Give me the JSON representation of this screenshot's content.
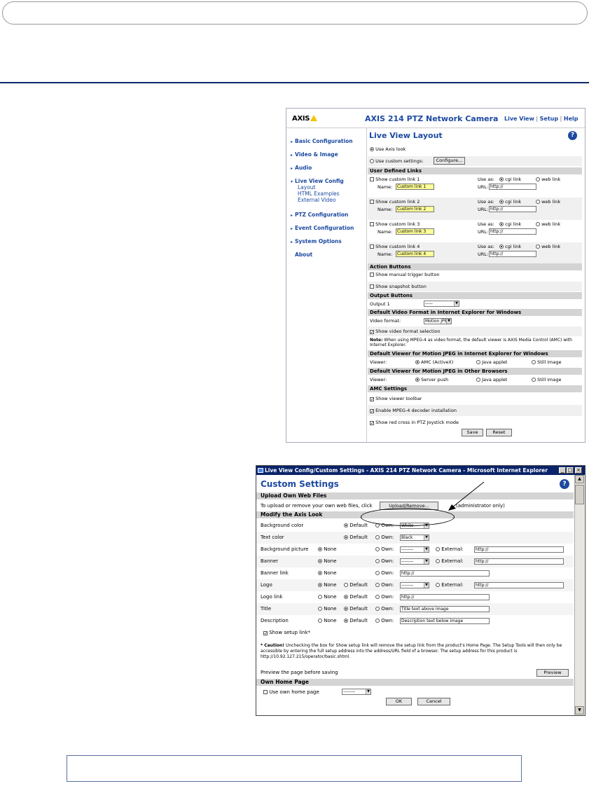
{
  "shot1": {
    "brand": "AXIS",
    "camera_title": "AXIS 214 PTZ Network Camera",
    "top_links": [
      "Live View",
      "Setup",
      "Help"
    ],
    "nav": [
      {
        "label": "Basic Configuration"
      },
      {
        "label": "Video & Image"
      },
      {
        "label": "Audio"
      },
      {
        "label": "Live View Config"
      },
      {
        "label": "PTZ Configuration"
      },
      {
        "label": "Event Configuration"
      },
      {
        "label": "System Options"
      },
      {
        "label": "About"
      }
    ],
    "nav_sub": [
      "Layout",
      "HTML Examples",
      "External Video"
    ],
    "page_title": "Live View Layout",
    "help_glyph": "?",
    "use_axis_look": "Use Axis look",
    "use_custom": "Use custom settings:",
    "configure_btn": "Configure...",
    "sec_user_links": "User Defined Links",
    "links": [
      {
        "show": "Show custom link 1",
        "name_label": "Name:",
        "name": "Custom link 1",
        "use_as": "Use as:",
        "cgi": "cgi link",
        "web": "web link",
        "url_label": "URL:",
        "url": "http://"
      },
      {
        "show": "Show custom link 2",
        "name_label": "Name:",
        "name": "Custom link 2",
        "use_as": "Use as:",
        "cgi": "cgi link",
        "web": "web link",
        "url_label": "URL:",
        "url": "http://"
      },
      {
        "show": "Show custom link 3",
        "name_label": "Name:",
        "name": "Custom link 3",
        "use_as": "Use as:",
        "cgi": "cgi link",
        "web": "web link",
        "url_label": "URL:",
        "url": "http://"
      },
      {
        "show": "Show custom link 4",
        "name_label": "Name:",
        "name": "Custom link 4",
        "use_as": "Use as:",
        "cgi": "cgi link",
        "web": "web link",
        "url_label": "URL:",
        "url": "http://"
      }
    ],
    "sec_action": "Action Buttons",
    "manual_trigger": "Show manual trigger button",
    "snapshot": "Show snapshot button",
    "sec_output": "Output Buttons",
    "output1": "Output 1",
    "output1_value": "-----",
    "sec_default_format": "Default Video Format in Internet Explorer for Windows",
    "video_format_label": "Video format:",
    "video_format_value": "Motion JPEG",
    "show_format_sel": "Show video format selection",
    "note_bold": "Note:",
    "note": "When using MPEG-4 as video format, the default viewer is AXIS Media Control (AMC) with Internet Explorer.",
    "sec_viewer_ie": "Default Viewer for Motion JPEG in Internet Explorer for Windows",
    "viewer_label": "Viewer:",
    "ie_opts": [
      "AMC (ActiveX)",
      "Java applet",
      "Still image"
    ],
    "sec_viewer_other": "Default Viewer for Motion JPEG in Other Browsers",
    "other_opts": [
      "Server push",
      "Java applet",
      "Still image"
    ],
    "sec_amc": "AMC Settings",
    "amc_opts": [
      "Show viewer toolbar",
      "Enable MPEG-4 decoder installation",
      "Show red cross in PTZ Joystick mode"
    ],
    "save": "Save",
    "reset": "Reset"
  },
  "shot2": {
    "window_title": "Live View Config/Custom Settings - AXIS 214 PTZ Network Camera - Microsoft Internet Explorer",
    "win_btns": [
      "_",
      "□",
      "×"
    ],
    "page_title": "Custom Settings",
    "help_glyph": "?",
    "sec_upload": "Upload Own Web Files",
    "upload_text": "To upload or remove your own web files, click",
    "upload_btn": "Upload/Remove...",
    "admin_only": "(administrator only)",
    "sec_modify": "Modify the Axis Look",
    "rows": [
      {
        "label": "Background color",
        "sel": "White"
      },
      {
        "label": "Text color",
        "sel": "Black"
      },
      {
        "label": "Background picture",
        "sel": "--------",
        "ext": "http://"
      },
      {
        "label": "Banner",
        "sel": "--------",
        "ext": "http://"
      },
      {
        "label": "Banner link",
        "url": "http://"
      },
      {
        "label": "Logo",
        "sel": "--------",
        "ext": "http://"
      },
      {
        "label": "Logo link",
        "url": "http://"
      },
      {
        "label": "Title",
        "url": "Title text above image"
      },
      {
        "label": "Description",
        "url": "Description text below image"
      }
    ],
    "none": "None",
    "default": "Default",
    "own": "Own:",
    "external": "External:",
    "show_setup": "Show setup link*",
    "caution_bold": "* Caution!",
    "caution": "Unchecking the box for Show setup link will remove the setup link from the product's Home Page. The Setup Tools will then only be accessible by entering the full setup address into the address/URL field of a browser. The setup address for this product is http://10.92.127.215/operator/basic.shtml.",
    "preview_text": "Preview the page before saving",
    "preview_btn": "Preview",
    "sec_home": "Own Home Page",
    "use_home": "Use own home page",
    "home_sel": "--------",
    "ok": "OK",
    "cancel": "Cancel"
  }
}
